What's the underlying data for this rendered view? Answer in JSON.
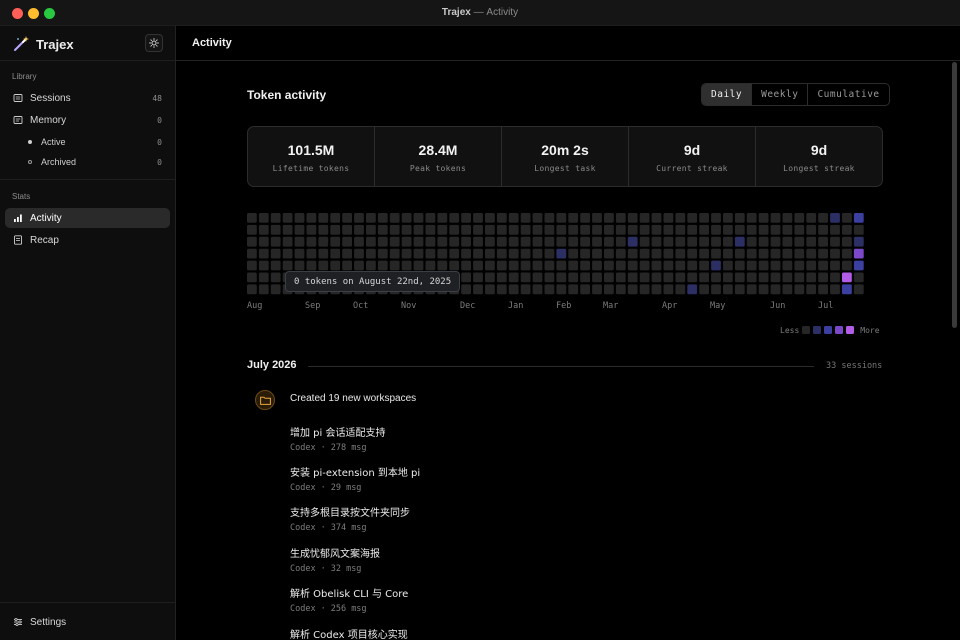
{
  "window": {
    "app": "Trajex",
    "separator": "—",
    "section": "Activity"
  },
  "sidebar": {
    "brand": "Trajex",
    "library_heading": "Library",
    "stats_heading": "Stats",
    "sessions": {
      "label": "Sessions",
      "count": "48"
    },
    "memory": {
      "label": "Memory",
      "count": "0"
    },
    "memory_active": {
      "label": "Active",
      "count": "0"
    },
    "memory_archived": {
      "label": "Archived",
      "count": "0"
    },
    "activity": {
      "label": "Activity"
    },
    "recap": {
      "label": "Recap"
    },
    "settings": {
      "label": "Settings"
    }
  },
  "main": {
    "title": "Activity",
    "token_activity_title": "Token activity",
    "tabs": [
      {
        "label": "Daily",
        "selected": true
      },
      {
        "label": "Weekly",
        "selected": false
      },
      {
        "label": "Cumulative",
        "selected": false
      }
    ],
    "stats": [
      {
        "value": "101.5M",
        "label": "Lifetime tokens"
      },
      {
        "value": "28.4M",
        "label": "Peak tokens"
      },
      {
        "value": "20m 2s",
        "label": "Longest task"
      },
      {
        "value": "9d",
        "label": "Current streak"
      },
      {
        "value": "9d",
        "label": "Longest streak"
      }
    ],
    "heatmap": {
      "weeks": 52,
      "months": [
        "Aug",
        "Sep",
        "Oct",
        "Nov",
        "Dec",
        "Jan",
        "Feb",
        "Mar",
        "Apr",
        "May",
        "Jun",
        "Jul"
      ],
      "tooltip": "0 tokens on August 22nd, 2025",
      "legend_less": "Less",
      "legend_more": "More",
      "colors": [
        "#262626",
        "#2b2f63",
        "#3b3fa0",
        "#7a48c8",
        "#b25ce8"
      ],
      "active_cells": [
        {
          "week": 49,
          "day": 0,
          "level": 1
        },
        {
          "week": 51,
          "day": 0,
          "level": 2
        },
        {
          "week": 32,
          "day": 2,
          "level": 1
        },
        {
          "week": 41,
          "day": 2,
          "level": 1
        },
        {
          "week": 51,
          "day": 2,
          "level": 1
        },
        {
          "week": 26,
          "day": 3,
          "level": 1
        },
        {
          "week": 51,
          "day": 3,
          "level": 3
        },
        {
          "week": 39,
          "day": 4,
          "level": 1
        },
        {
          "week": 51,
          "day": 4,
          "level": 2
        },
        {
          "week": 50,
          "day": 5,
          "level": 4
        },
        {
          "week": 37,
          "day": 6,
          "level": 1
        },
        {
          "week": 50,
          "day": 6,
          "level": 2
        }
      ]
    },
    "month_section": {
      "title": "July 2026",
      "count": "33 sessions",
      "event_title": "Created 19 new workspaces",
      "workspaces": [
        {
          "title": "增加 pi 会话适配支持",
          "agent": "Codex",
          "sep": "·",
          "msgs": "278 msg"
        },
        {
          "title": "安装 pi-extension 到本地 pi",
          "agent": "Codex",
          "sep": "·",
          "msgs": "29 msg"
        },
        {
          "title": "支持多根目录按文件夹同步",
          "agent": "Codex",
          "sep": "·",
          "msgs": "374 msg"
        },
        {
          "title": "生成忧郁风文案海报",
          "agent": "Codex",
          "sep": "·",
          "msgs": "32 msg"
        },
        {
          "title": "解析 Obelisk CLI 与 Core",
          "agent": "Codex",
          "sep": "·",
          "msgs": "256 msg"
        },
        {
          "title": "解析 Codex 项目核心实现",
          "agent": "",
          "sep": "",
          "msgs": ""
        }
      ]
    }
  }
}
